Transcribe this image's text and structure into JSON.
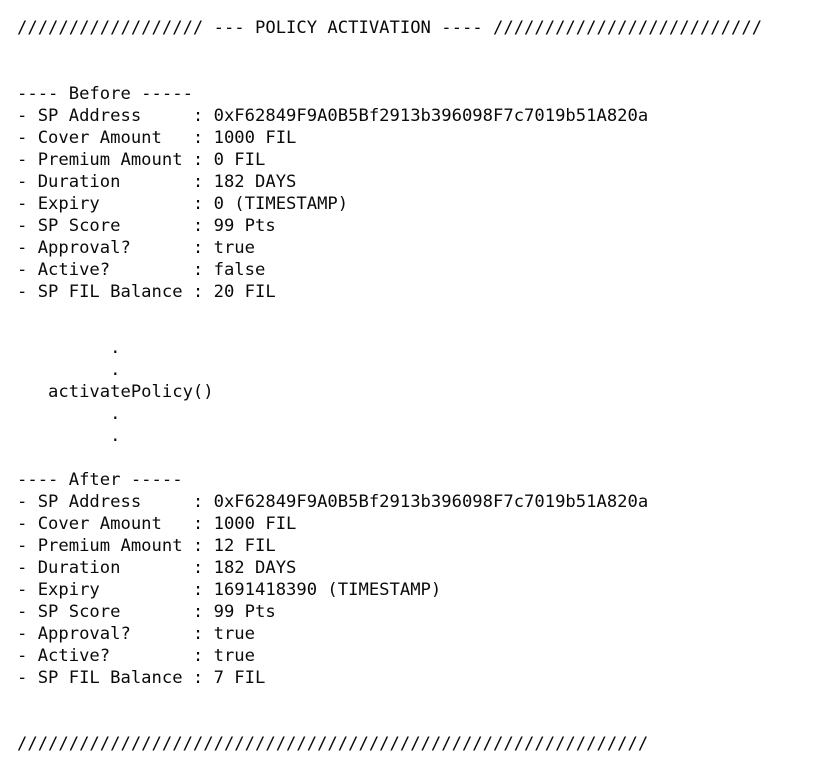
{
  "header": {
    "rule_left": "//////////////////",
    "dash_left": "---",
    "title": "POLICY ACTIVATION",
    "dash_right": "----",
    "rule_right": "//////////////////////////",
    "full_line": "////////////////// --- POLICY ACTIVATION ---- //////////////////////////"
  },
  "before": {
    "heading": "---- Before -----",
    "rows": [
      {
        "label": "- SP Address",
        "sep": ":",
        "value": "0xF62849F9A0B5Bf2913b396098F7c7019b51A820a",
        "line": "- SP Address     : 0xF62849F9A0B5Bf2913b396098F7c7019b51A820a"
      },
      {
        "label": "- Cover Amount",
        "sep": ":",
        "value": "1000 FIL",
        "line": "- Cover Amount   : 1000 FIL"
      },
      {
        "label": "- Premium Amount",
        "sep": ":",
        "value": "0 FIL",
        "line": "- Premium Amount : 0 FIL"
      },
      {
        "label": "- Duration",
        "sep": ":",
        "value": "182 DAYS",
        "line": "- Duration       : 182 DAYS"
      },
      {
        "label": "- Expiry",
        "sep": ":",
        "value": "0 (TIMESTAMP)",
        "line": "- Expiry         : 0 (TIMESTAMP)"
      },
      {
        "label": "- SP Score",
        "sep": ":",
        "value": "99 Pts",
        "line": "- SP Score       : 99 Pts"
      },
      {
        "label": "- Approval?",
        "sep": ":",
        "value": "true",
        "line": "- Approval?      : true"
      },
      {
        "label": "- Active?",
        "sep": ":",
        "value": "false",
        "line": "- Active?        : false"
      },
      {
        "label": "- SP FIL Balance",
        "sep": ":",
        "value": "20 FIL",
        "line": "- SP FIL Balance : 20 FIL"
      }
    ]
  },
  "flow": {
    "dot": ".",
    "dot_indent": "         .",
    "call": "   activatePolicy()",
    "call_label": "activatePolicy()",
    "dots_before": 2,
    "dots_after": 2
  },
  "after": {
    "heading": "---- After -----",
    "rows": [
      {
        "label": "- SP Address",
        "sep": ":",
        "value": "0xF62849F9A0B5Bf2913b396098F7c7019b51A820a",
        "line": "- SP Address     : 0xF62849F9A0B5Bf2913b396098F7c7019b51A820a"
      },
      {
        "label": "- Cover Amount",
        "sep": ":",
        "value": "1000 FIL",
        "line": "- Cover Amount   : 1000 FIL"
      },
      {
        "label": "- Premium Amount",
        "sep": ":",
        "value": "12 FIL",
        "line": "- Premium Amount : 12 FIL"
      },
      {
        "label": "- Duration",
        "sep": ":",
        "value": "182 DAYS",
        "line": "- Duration       : 182 DAYS"
      },
      {
        "label": "- Expiry",
        "sep": ":",
        "value": "1691418390 (TIMESTAMP)",
        "line": "- Expiry         : 1691418390 (TIMESTAMP)"
      },
      {
        "label": "- SP Score",
        "sep": ":",
        "value": "99 Pts",
        "line": "- SP Score       : 99 Pts"
      },
      {
        "label": "- Approval?",
        "sep": ":",
        "value": "true",
        "line": "- Approval?      : true"
      },
      {
        "label": "- Active?",
        "sep": ":",
        "value": "true",
        "line": "- Active?        : true"
      },
      {
        "label": "- SP FIL Balance",
        "sep": ":",
        "value": "7 FIL",
        "line": "- SP FIL Balance : 7 FIL"
      }
    ]
  },
  "footer": {
    "rule": "/////////////////////////////////////////////////////////////"
  },
  "colors": {
    "background": "#ffffff",
    "text": "#0a0a0a"
  }
}
